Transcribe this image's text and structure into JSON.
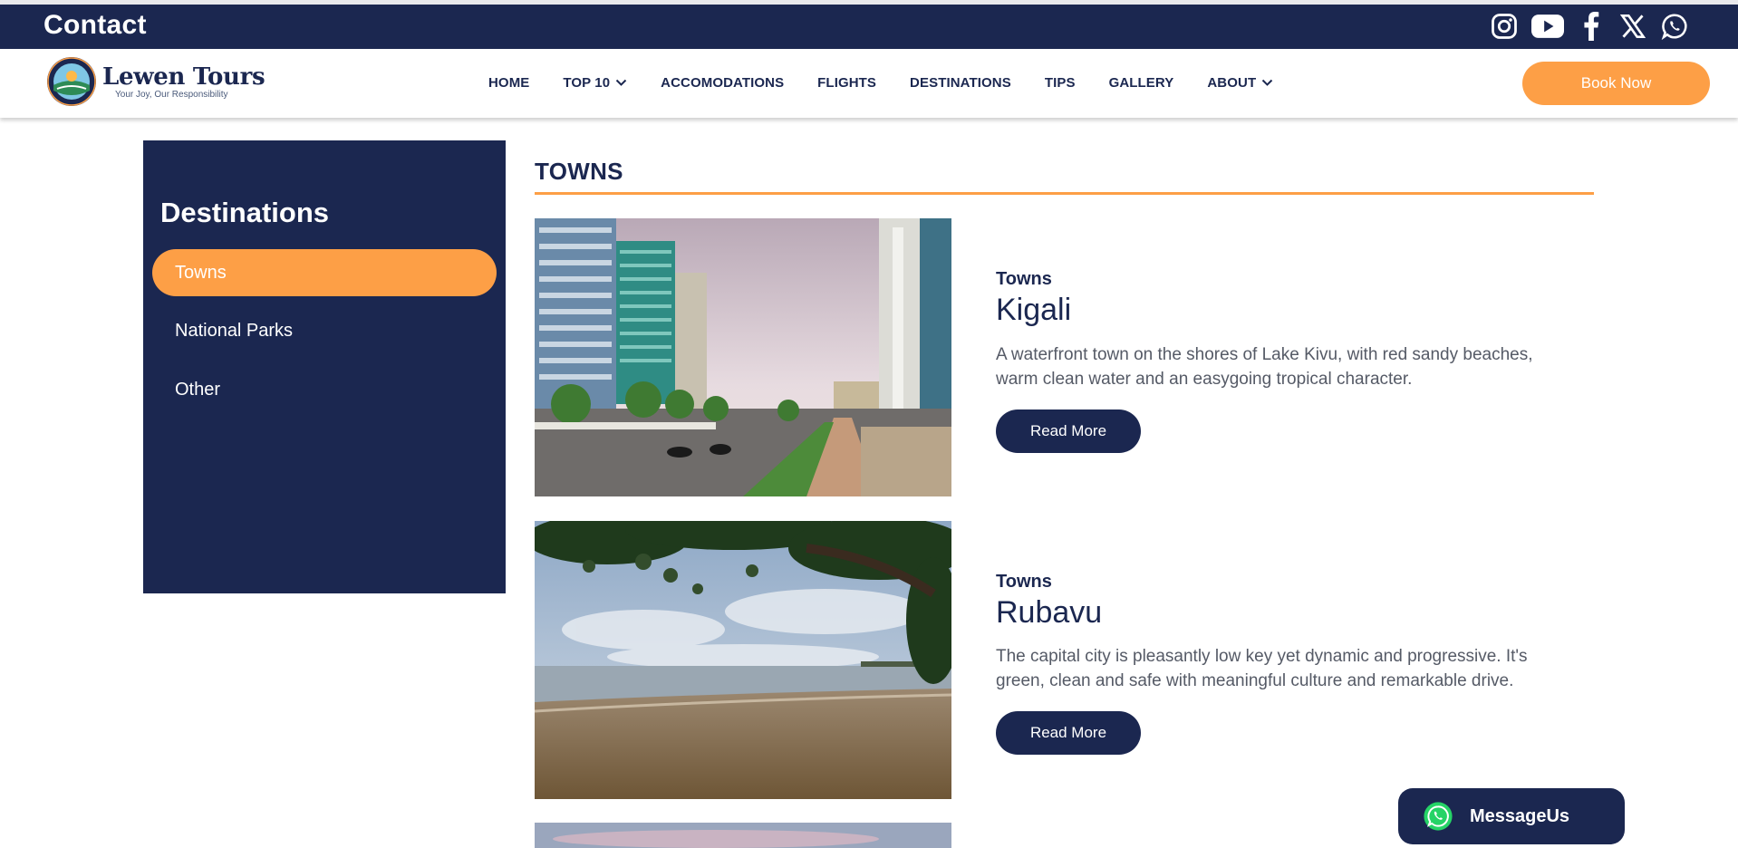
{
  "topbar": {
    "contact_label": "Contact",
    "social_icons": [
      "instagram-icon",
      "youtube-icon",
      "facebook-icon",
      "x-icon",
      "whatsapp-icon"
    ]
  },
  "brand": {
    "name": "Lewen Tours",
    "tagline": "Your Joy, Our Responsibility"
  },
  "nav": {
    "items": [
      {
        "label": "HOME"
      },
      {
        "label": "TOP 10"
      },
      {
        "label": "ACCOMODATIONS"
      },
      {
        "label": "FLIGHTS"
      },
      {
        "label": "DESTINATIONS"
      },
      {
        "label": "TIPS"
      },
      {
        "label": "GALLERY"
      },
      {
        "label": "ABOUT"
      }
    ],
    "book_now": "Book Now"
  },
  "sidebar": {
    "title": "Destinations",
    "items": [
      {
        "label": "Towns"
      },
      {
        "label": "National Parks"
      },
      {
        "label": "Other"
      }
    ]
  },
  "main": {
    "section_title": "TOWNS",
    "cards": [
      {
        "category": "Towns",
        "title": "Kigali",
        "description": "A waterfront town on the shores of Lake Kivu, with red sandy beaches, warm clean water and an easygoing tropical character.",
        "button": "Read More"
      },
      {
        "category": "Towns",
        "title": "Rubavu",
        "description": "The capital city is pleasantly low key yet dynamic and progressive. It's green, clean and safe with meaningful culture and remarkable drive.",
        "button": "Read More"
      }
    ]
  },
  "widget": {
    "label": "MessageUs"
  },
  "colors": {
    "navy": "#1b2750",
    "orange": "#fd9f46",
    "whatsapp": "#25d366"
  }
}
